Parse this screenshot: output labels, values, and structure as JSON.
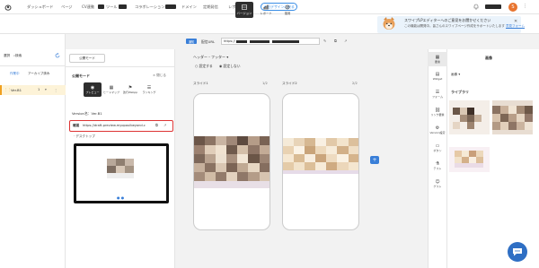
{
  "topnav": {
    "items": [
      {
        "label": "ダッシュボード"
      },
      {
        "label": "ページ"
      },
      {
        "label": "CV連動"
      },
      {
        "label": "ツール"
      },
      {
        "label": "コラボレーション"
      },
      {
        "label": "ドメイン"
      },
      {
        "label": "定期発信"
      },
      {
        "label": "レポート発行"
      }
    ],
    "new_design_label": "旧デザインに戻る",
    "avatar_initial": "S"
  },
  "toolbar": {
    "version_label": "バージョン",
    "report_label": "レポート",
    "operate_label": "運用"
  },
  "banner": {
    "line1": "スワイプLPエディターへのご意見をお聞かせください",
    "line2": "この機能は開発中。皆さんのスワイプページ作成をサポートいたします",
    "link": "意見フォーム"
  },
  "dest": {
    "badge": "通知",
    "label": "配信URL",
    "url": "https://"
  },
  "left": {
    "select": "選択",
    "search": "検索",
    "tab_working": "作業中",
    "tab_archive": "アーカイブ済み",
    "variant": "Ver.B1",
    "variant_count": "1"
  },
  "version_panel": {
    "copy_button": "公開モード",
    "publish_label": "公開モード",
    "close_label": "閉じる",
    "tools": [
      {
        "label": "プレビュー"
      },
      {
        "label": "ヒートマップ"
      },
      {
        "label": "改行Webpp"
      },
      {
        "label": "ランキング"
      }
    ],
    "version_name": "Version名：Ver.B1",
    "url_label": "確認",
    "url": "https://draft-preview.myopaulbeyond.c",
    "desktop_label": "デスクトップ",
    "dots": "● ●"
  },
  "canvas": {
    "header_footer_label": "ヘッダー・フッター",
    "radio_on": "設定する",
    "radio_off": "設定しない",
    "slides": [
      {
        "label": "スライド1",
        "count": "1/2"
      },
      {
        "label": "スライド2",
        "count": "2/2"
      }
    ],
    "add_label": "+"
  },
  "right_sidebar": {
    "items": [
      {
        "label": "要素"
      },
      {
        "label": "Widget"
      },
      {
        "label": "フォーム"
      },
      {
        "label": "リンク要素"
      },
      {
        "label": "Version設定"
      },
      {
        "label": "ボタン"
      },
      {
        "label": "テスト"
      },
      {
        "label": "ゲスト"
      }
    ]
  },
  "material": {
    "title": "画像",
    "filter": "画像",
    "library": "ライブラリ"
  },
  "colors": {
    "accent": "#3a7fd8",
    "dark": "#2e2e2e",
    "highlight": "#d33333",
    "avatar": "#e8742f"
  }
}
